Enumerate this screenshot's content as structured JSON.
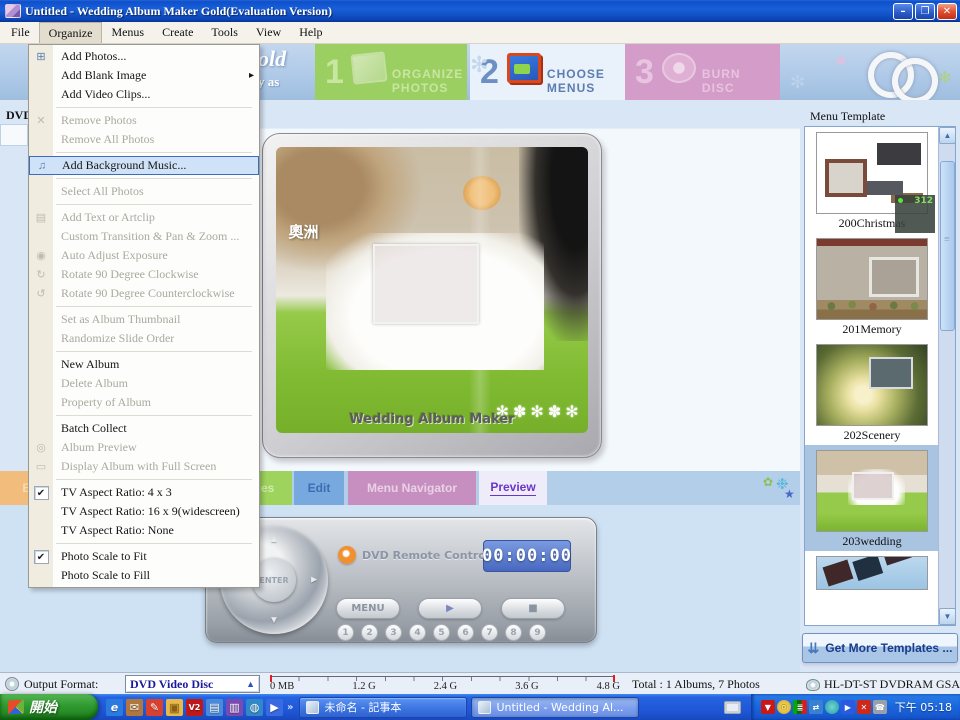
{
  "window": {
    "title": "Untitled - Wedding Album Maker Gold(Evaluation Version)",
    "controls": {
      "minimize": "–",
      "restore": "❐",
      "close": "✕"
    }
  },
  "menubar": {
    "items": [
      {
        "label": "File",
        "cls": "",
        "name": "menubar-file"
      },
      {
        "label": "Organize",
        "cls": "open",
        "name": "menubar-organize"
      },
      {
        "label": "Menus",
        "cls": "",
        "name": "menubar-menus"
      },
      {
        "label": "Create",
        "cls": "",
        "name": "menubar-create"
      },
      {
        "label": "Tools",
        "cls": "",
        "name": "menubar-tools"
      },
      {
        "label": "View",
        "cls": "",
        "name": "menubar-view"
      },
      {
        "label": "Help",
        "cls": "",
        "name": "menubar-help"
      }
    ]
  },
  "banner": {
    "logo_fragment_top": "old",
    "logo_fragment_bottom": "y as",
    "steps": [
      {
        "num": "1",
        "label": "ORGANIZE PHOTOS",
        "cls": "step-green",
        "name": "step-1-organize-photos"
      },
      {
        "num": "2",
        "label": "CHOOSE MENUS",
        "cls": "step-active",
        "name": "step-2-choose-menus"
      },
      {
        "num": "3",
        "label": "BURN  DISC",
        "cls": "step-pink",
        "name": "step-3-burn-disc"
      }
    ],
    "flowers": [
      {
        "glyph": "✻",
        "cls": "bf1"
      },
      {
        "glyph": "✻",
        "cls": "bf2"
      },
      {
        "glyph": "✽",
        "cls": "bf3"
      },
      {
        "glyph": "✻",
        "cls": "bf4"
      }
    ]
  },
  "organize_menu": {
    "items": [
      {
        "glyph": "⊞",
        "label": "Add Photos...",
        "cls": "",
        "arrow": ""
      },
      {
        "glyph": "",
        "label": "Add Blank Image",
        "cls": "",
        "arrow": "▸"
      },
      {
        "glyph": "",
        "label": "Add Video Clips...",
        "cls": "",
        "arrow": ""
      },
      {
        "glyph": "",
        "label": "",
        "cls": "sep",
        "arrow": ""
      },
      {
        "glyph": "✕",
        "label": "Remove Photos",
        "cls": "dis",
        "arrow": ""
      },
      {
        "glyph": "",
        "label": "Remove All Photos",
        "cls": "dis",
        "arrow": ""
      },
      {
        "glyph": "",
        "label": "",
        "cls": "sep",
        "arrow": ""
      },
      {
        "glyph": "♫",
        "label": "Add Background Music...",
        "cls": "hl",
        "arrow": ""
      },
      {
        "glyph": "",
        "label": "",
        "cls": "sep",
        "arrow": ""
      },
      {
        "glyph": "",
        "label": "Select All Photos",
        "cls": "dis",
        "arrow": ""
      },
      {
        "glyph": "",
        "label": "",
        "cls": "sep",
        "arrow": ""
      },
      {
        "glyph": "▤",
        "label": "Add Text or Artclip",
        "cls": "dis",
        "arrow": ""
      },
      {
        "glyph": "",
        "label": "Custom Transition & Pan & Zoom ...",
        "cls": "dis",
        "arrow": ""
      },
      {
        "glyph": "◉",
        "label": "Auto Adjust Exposure",
        "cls": "dis",
        "arrow": ""
      },
      {
        "glyph": "↻",
        "label": "Rotate 90 Degree Clockwise",
        "cls": "dis",
        "arrow": ""
      },
      {
        "glyph": "↺",
        "label": "Rotate 90 Degree Counterclockwise",
        "cls": "dis",
        "arrow": ""
      },
      {
        "glyph": "",
        "label": "",
        "cls": "sep",
        "arrow": ""
      },
      {
        "glyph": "",
        "label": "Set as Album Thumbnail",
        "cls": "dis",
        "arrow": ""
      },
      {
        "glyph": "",
        "label": "Randomize Slide Order",
        "cls": "dis",
        "arrow": ""
      },
      {
        "glyph": "",
        "label": "",
        "cls": "sep",
        "arrow": ""
      },
      {
        "glyph": "",
        "label": "New Album",
        "cls": "",
        "arrow": ""
      },
      {
        "glyph": "",
        "label": "Delete Album",
        "cls": "dis",
        "arrow": ""
      },
      {
        "glyph": "",
        "label": "Property of Album",
        "cls": "dis",
        "arrow": ""
      },
      {
        "glyph": "",
        "label": "",
        "cls": "sep",
        "arrow": ""
      },
      {
        "glyph": "",
        "label": "Batch Collect",
        "cls": "",
        "arrow": ""
      },
      {
        "glyph": "◎",
        "label": "Album Preview",
        "cls": "dis",
        "arrow": ""
      },
      {
        "glyph": "▭",
        "label": "Display Album with Full Screen",
        "cls": "dis",
        "arrow": ""
      },
      {
        "glyph": "",
        "label": "",
        "cls": "sep",
        "arrow": ""
      },
      {
        "glyph": "✔",
        "label": "TV Aspect Ratio:  4 x 3",
        "cls": "chk",
        "arrow": ""
      },
      {
        "glyph": "",
        "label": "TV Aspect Ratio: 16 x 9(widescreen)",
        "cls": "",
        "arrow": ""
      },
      {
        "glyph": "",
        "label": "TV Aspect Ratio: None",
        "cls": "",
        "arrow": ""
      },
      {
        "glyph": "",
        "label": "",
        "cls": "sep",
        "arrow": ""
      },
      {
        "glyph": "✔",
        "label": "Photo Scale to Fit",
        "cls": "chk",
        "arrow": ""
      },
      {
        "glyph": "",
        "label": "Photo Scale to Fill",
        "cls": "",
        "arrow": ""
      }
    ]
  },
  "workspace": {
    "dvd_label": "DVD",
    "preview": {
      "photo_text": "奧洲",
      "watermark": "Wedding Album Maker",
      "flowers": "✻ ✽ ✻ ✽ ✻"
    }
  },
  "tabbar": {
    "tabs": [
      {
        "label": "Ba",
        "cls": "tab-orange",
        "name": "tab-orange-partial"
      },
      {
        "label": "ges",
        "cls": "tab-green",
        "name": "tab-green-partial"
      },
      {
        "label": "Edit",
        "cls": "tab-blue",
        "name": "tab-edit"
      },
      {
        "label": "Menu Navigator",
        "cls": "tab-pink",
        "name": "tab-menu-navigator"
      },
      {
        "label": "Preview",
        "cls": "tab-active",
        "name": "tab-preview"
      }
    ],
    "decor": [
      {
        "glyph": "✿",
        "cls": "td1"
      },
      {
        "glyph": "❉",
        "cls": "td2"
      },
      {
        "glyph": "★",
        "cls": "td3"
      }
    ]
  },
  "remote": {
    "title": "DVD Remote Control",
    "time": "00:00:00",
    "enter": "ENTER",
    "arrows": {
      "up": "▲",
      "down": "▼",
      "left": "◄",
      "right": "►"
    },
    "menu_button": "MENU",
    "play_glyph": "▶",
    "stop_glyph": "■",
    "numbers": [
      "1",
      "2",
      "3",
      "4",
      "5",
      "6",
      "7",
      "8",
      "9"
    ]
  },
  "sidebar": {
    "title": "Menu Template",
    "scroll_up": "▲",
    "scroll_down": "▼",
    "templates": [
      {
        "name": "200Christmas",
        "cls": "t-christmas",
        "badge": "312"
      },
      {
        "name": "201Memory",
        "cls": "t-memory",
        "badge": ""
      },
      {
        "name": "202Scenery",
        "cls": "t-scenery",
        "badge": ""
      },
      {
        "name": "203wedding",
        "cls": "t-wedding sel",
        "badge": ""
      },
      {
        "name": "",
        "cls": "t-partial",
        "badge": ""
      }
    ],
    "get_more": "Get More Templates ...",
    "get_more_glyph": "⇊"
  },
  "statusbar": {
    "output_label": "Output Format:",
    "output_value": "DVD Video Disc",
    "dropdown_glyph": "▲",
    "scale": [
      "0 MB",
      "1.2 G",
      "2.4 G",
      "3.6 G",
      "4.8 G"
    ],
    "total": "Total : 1 Albums, 7 Photos",
    "drive": "HL-DT-ST DVDRAM GSA-H"
  },
  "taskbar": {
    "start": "開始",
    "overflow": "»",
    "quicklaunch": [
      {
        "glyph": "e",
        "cls": "q-ie",
        "name": "quicklaunch-ie-icon"
      },
      {
        "glyph": "✉",
        "cls": "q-mail",
        "name": "quicklaunch-mail-icon"
      },
      {
        "glyph": "✎",
        "cls": "q-paint",
        "name": "quicklaunch-paint-icon"
      },
      {
        "glyph": "▣",
        "cls": "q-folder",
        "name": "quicklaunch-folder-icon"
      },
      {
        "glyph": "V2",
        "cls": "q-v2",
        "name": "quicklaunch-antivirus-icon"
      },
      {
        "glyph": "▤",
        "cls": "q-doc",
        "name": "quicklaunch-document-icon"
      },
      {
        "glyph": "▥",
        "cls": "q-book",
        "name": "quicklaunch-reader-icon"
      },
      {
        "glyph": "◍",
        "cls": "q-globe",
        "name": "quicklaunch-browser-icon"
      },
      {
        "glyph": "▶",
        "cls": "q-media",
        "name": "quicklaunch-media-player-icon"
      }
    ],
    "tasks": [
      {
        "label": "未命名 - 記事本",
        "cls": "",
        "name": "task-notepad"
      },
      {
        "label": "Untitled - Wedding Al...",
        "cls": "active",
        "name": "task-wedding-album-maker"
      }
    ],
    "tray": [
      {
        "glyph": "▼",
        "cls": "t-red",
        "name": "tray-alert-icon"
      },
      {
        "glyph": "☉",
        "cls": "t-yellow",
        "name": "tray-status-icon"
      },
      {
        "glyph": "≣",
        "cls": "t-meter",
        "name": "tray-meter-icon"
      },
      {
        "glyph": "⇄",
        "cls": "t-net",
        "name": "tray-network-icon"
      },
      {
        "glyph": "",
        "cls": "t-msn",
        "name": "tray-messenger-icon"
      },
      {
        "glyph": "▶",
        "cls": "t-play",
        "name": "tray-media-icon"
      },
      {
        "glyph": "✕",
        "cls": "t-x",
        "name": "tray-disabled-icon"
      },
      {
        "glyph": "☎",
        "cls": "t-grey",
        "name": "tray-device-icon"
      }
    ],
    "clock": "下午 05:18"
  },
  "colors": {
    "xp_blue": "#1e55d4",
    "title_blue": "#0c50cc",
    "menu_highlight": "#cfe2f7",
    "menu_highlight_border": "#3a6cc0",
    "step_green": "#9ccf62",
    "step_pink": "#d49cc8",
    "grass_green": "#82bc34",
    "banner_blue": "#aac6e6",
    "tab_active_text": "#6a35c8",
    "remote_display": "#4868c0",
    "start_green": "#2f9a2f"
  }
}
